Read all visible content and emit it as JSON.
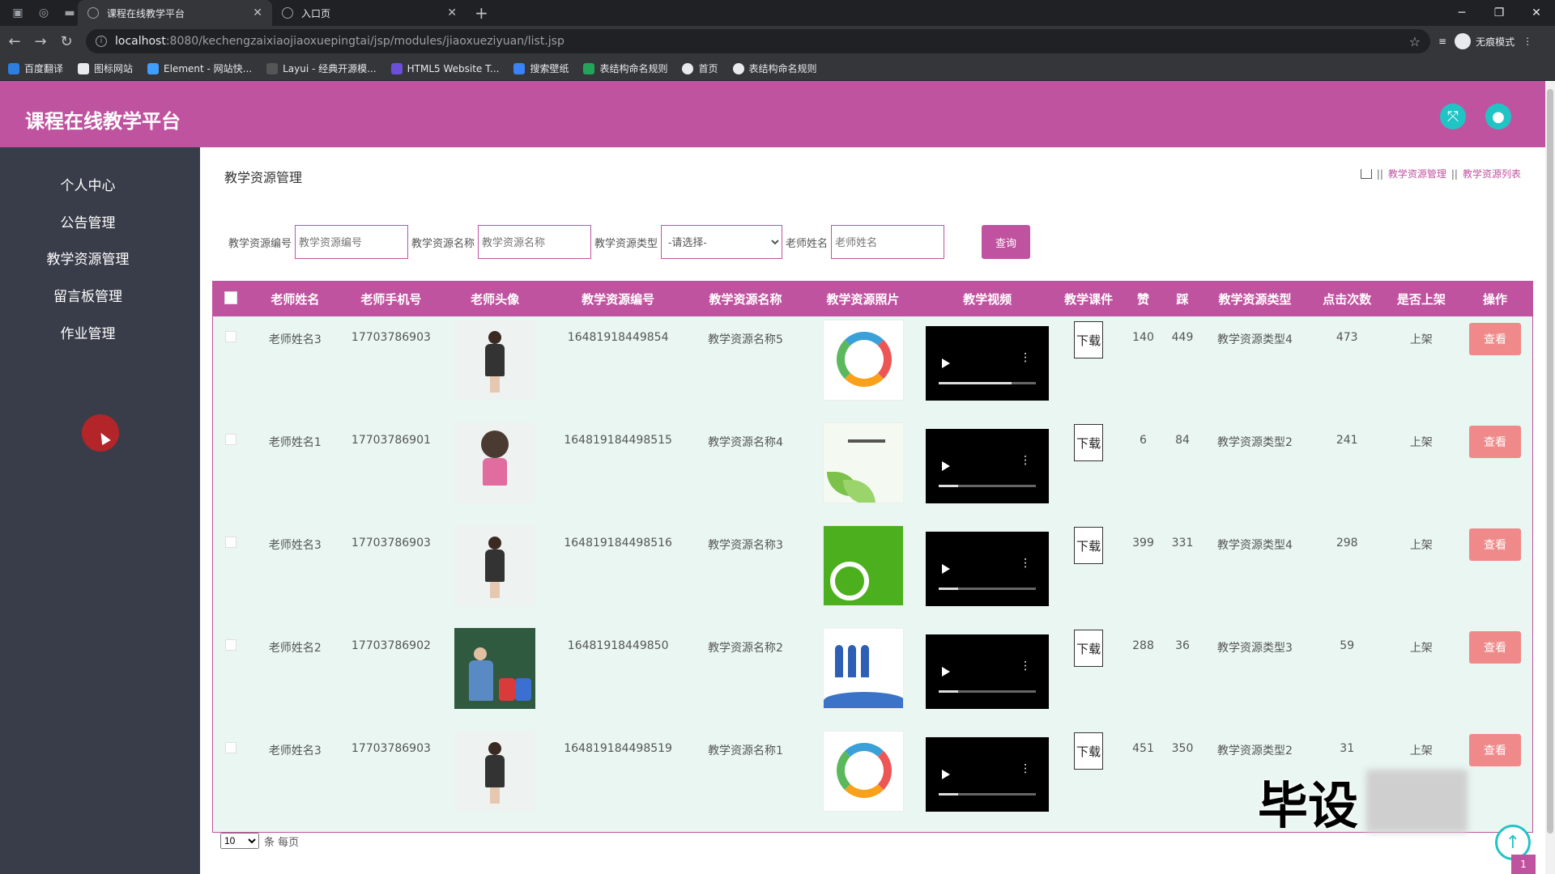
{
  "browser": {
    "tabs": [
      {
        "label": "课程在线教学平台",
        "active": true
      },
      {
        "label": "入口页",
        "active": false
      }
    ],
    "url_host": "localhost",
    "url_rest": ":8080/kechengzaixiaojiaoxuepingtai/jsp/modules/jiaoxueziyuan/list.jsp",
    "incognito_label": "无痕模式",
    "bookmarks": [
      "百度翻译",
      "图标网站",
      "Element - 网站快...",
      "Layui - 经典开源模...",
      "HTML5 Website T...",
      "搜索壁纸",
      "表结构命名规则",
      "首页",
      "表结构命名规则"
    ]
  },
  "app": {
    "title": "课程在线教学平台",
    "accent_color": "#c0539f"
  },
  "sidebar": {
    "items": [
      "个人中心",
      "公告管理",
      "教学资源管理",
      "留言板管理",
      "作业管理"
    ]
  },
  "page": {
    "title": "教学资源管理",
    "breadcrumb": [
      "教学资源管理",
      "教学资源列表"
    ]
  },
  "search": {
    "fields": [
      {
        "label": "教学资源编号",
        "placeholder": "教学资源编号"
      },
      {
        "label": "教学资源名称",
        "placeholder": "教学资源名称"
      },
      {
        "label": "教学资源类型",
        "selected": "-请选择-"
      },
      {
        "label": "老师姓名",
        "placeholder": "老师姓名"
      }
    ],
    "button_label": "查询"
  },
  "table": {
    "headers": [
      "老师姓名",
      "老师手机号",
      "老师头像",
      "教学资源编号",
      "教学资源名称",
      "教学资源照片",
      "教学视频",
      "教学课件",
      "赞",
      "踩",
      "教学资源类型",
      "点击次数",
      "是否上架",
      "操作"
    ],
    "download_label": "下载",
    "view_label": "查看",
    "rows": [
      {
        "name": "老师姓名3",
        "phone": "17703786903",
        "avatar": "teacher-standing",
        "code": "16481918449854",
        "res_name": "教学资源名称5",
        "photo": "ring-diagram",
        "video_progress": 0.75,
        "likes": "140",
        "dislikes": "449",
        "type": "教学资源类型4",
        "clicks": "473",
        "status": "上架"
      },
      {
        "name": "老师姓名1",
        "phone": "17703786901",
        "avatar": "teacher-cartoon",
        "code": "164819184498515",
        "res_name": "教学资源名称4",
        "photo": "leaf-title",
        "video_progress": 0.2,
        "likes": "6",
        "dislikes": "84",
        "type": "教学资源类型2",
        "clicks": "241",
        "status": "上架"
      },
      {
        "name": "老师姓名3",
        "phone": "17703786903",
        "avatar": "teacher-standing",
        "code": "164819184498516",
        "res_name": "教学资源名称3",
        "photo": "green-pie",
        "video_progress": 0.2,
        "likes": "399",
        "dislikes": "331",
        "type": "教学资源类型4",
        "clicks": "298",
        "status": "上架"
      },
      {
        "name": "老师姓名2",
        "phone": "17703786902",
        "avatar": "classroom",
        "code": "16481918449850",
        "res_name": "教学资源名称2",
        "photo": "people-wave",
        "video_progress": 0.2,
        "likes": "288",
        "dislikes": "36",
        "type": "教学资源类型3",
        "clicks": "59",
        "status": "上架"
      },
      {
        "name": "老师姓名3",
        "phone": "17703786903",
        "avatar": "teacher-standing",
        "code": "164819184498519",
        "res_name": "教学资源名称1",
        "photo": "ring-diagram",
        "video_progress": 0.2,
        "likes": "451",
        "dislikes": "350",
        "type": "教学资源类型2",
        "clicks": "31",
        "status": "上架"
      }
    ]
  },
  "pager": {
    "page_size": "10",
    "suffix": "条 每页",
    "current_page": "1"
  },
  "watermark": {
    "text": "毕设"
  }
}
